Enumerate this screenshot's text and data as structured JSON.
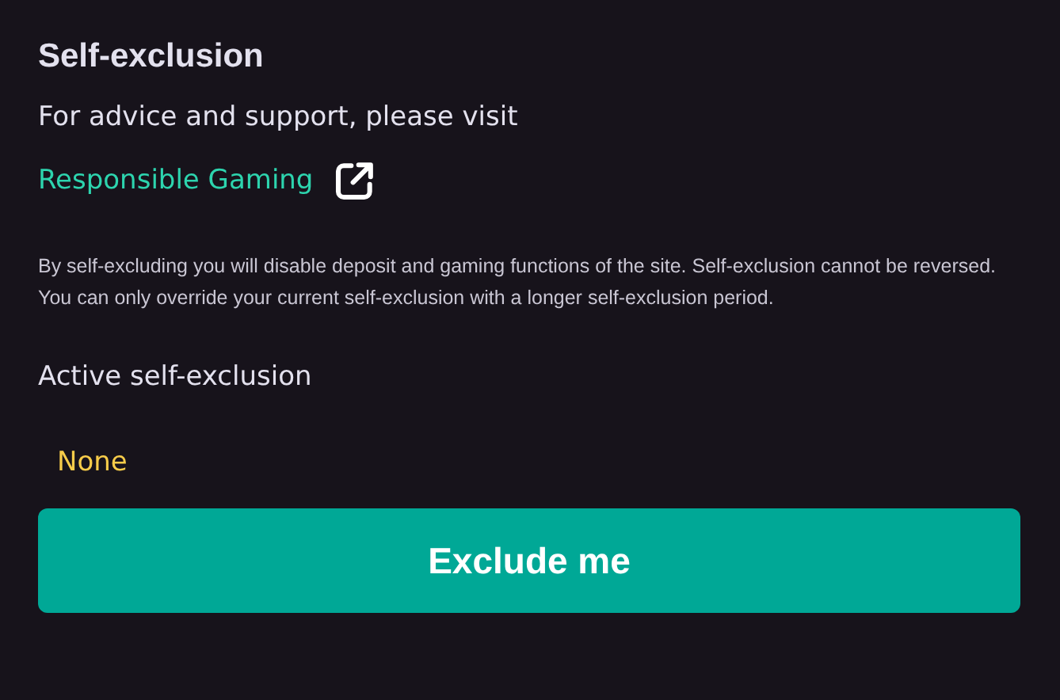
{
  "title": "Self-exclusion",
  "advice": "For advice and support, please visit",
  "link": {
    "label": "Responsible Gaming"
  },
  "notice": "By self-excluding you will disable deposit and gaming functions of the site. Self-exclusion cannot be reversed. You can only override your current self-exclusion with a longer self-exclusion period.",
  "active": {
    "label": "Active self-exclusion",
    "value": "None"
  },
  "button": {
    "label": "Exclude me"
  }
}
